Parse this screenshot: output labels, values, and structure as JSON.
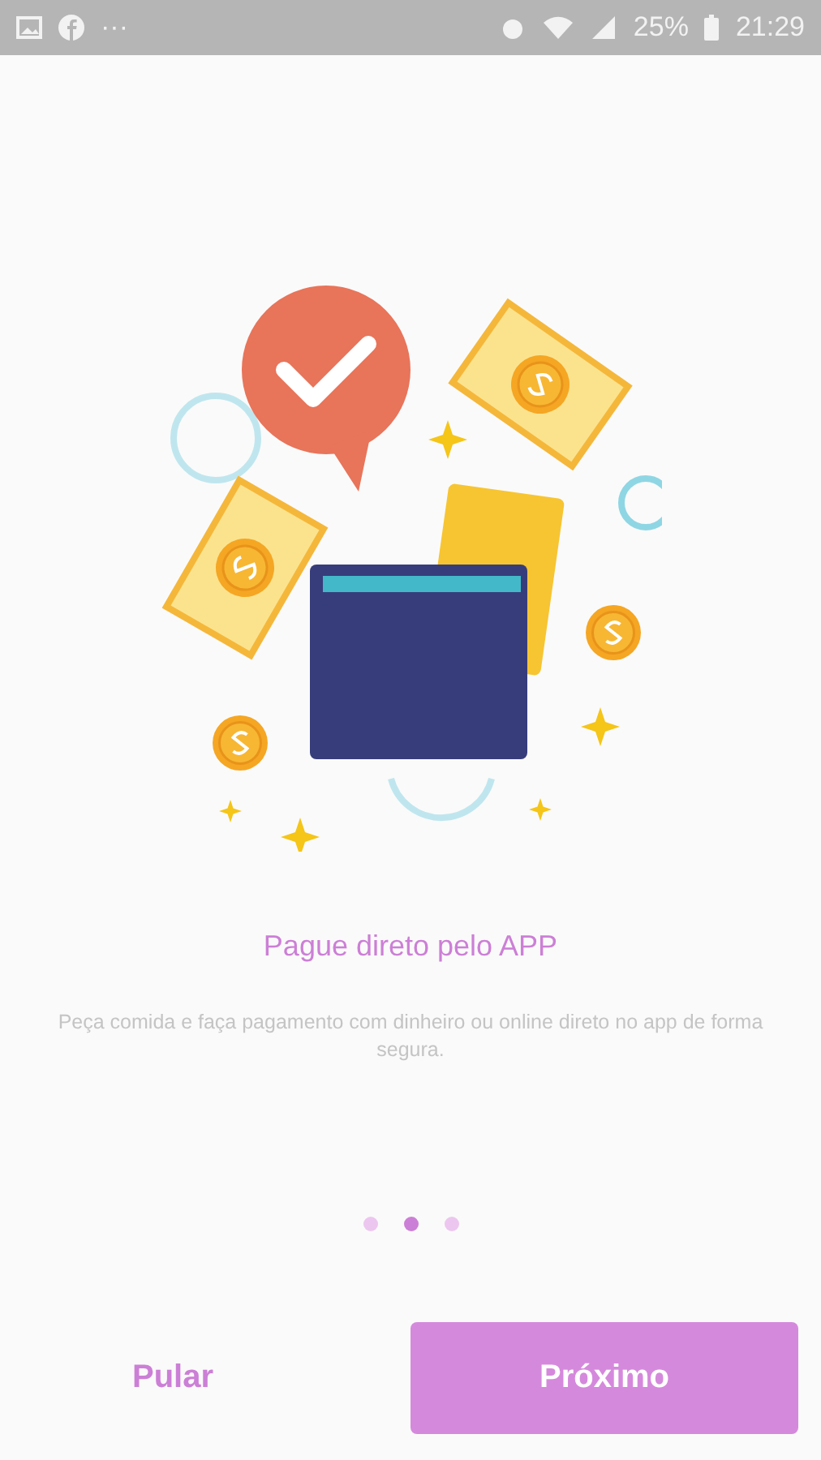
{
  "status_bar": {
    "more": "···",
    "battery": "25%",
    "time": "21:29"
  },
  "slide": {
    "title": "Pague direto pelo APP",
    "description": "Peça comida e faça pagamento com dinheiro ou online direto no app de forma segura."
  },
  "pager": [
    {
      "selected": false
    },
    {
      "selected": true
    },
    {
      "selected": false
    }
  ],
  "buttons": {
    "skip": "Pular",
    "next": "Próximo"
  }
}
